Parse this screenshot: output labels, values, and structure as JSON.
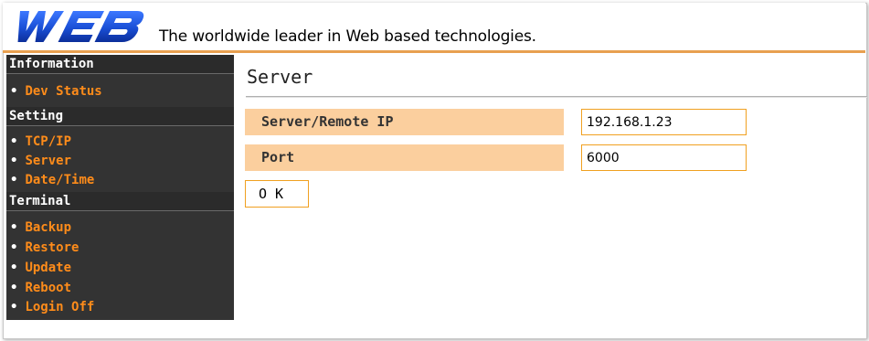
{
  "header": {
    "logo_text": "WEB",
    "tagline": "The worldwide leader in Web based technologies.",
    "logo_color": "#1a4fd6"
  },
  "sidebar": {
    "sections": [
      {
        "title": "Information",
        "items": [
          "Dev Status"
        ]
      },
      {
        "title": "Setting",
        "items": [
          "TCP/IP",
          "Server",
          "Date/Time"
        ]
      },
      {
        "title": "Terminal",
        "items": [
          "Backup",
          "Restore",
          "Update",
          "Reboot",
          "Login Off"
        ]
      }
    ],
    "bullet": "•",
    "item_color": "#ff8c1a"
  },
  "main": {
    "title": "Server",
    "fields": [
      {
        "label": "Server/Remote IP",
        "value": "192.168.1.23"
      },
      {
        "label": "Port",
        "value": "6000"
      }
    ],
    "ok_label": "O K"
  },
  "colors": {
    "accent": "#e8a050",
    "label_bg": "#fbcf9e",
    "input_border": "#f0a020",
    "sidebar_bg": "#333333"
  }
}
